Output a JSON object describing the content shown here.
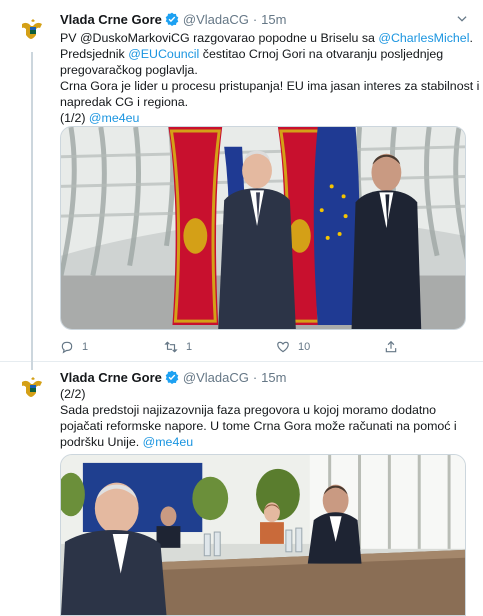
{
  "tweets": [
    {
      "author_name": "Vlada Crne Gore",
      "handle": "@VladaCG",
      "separator": "·",
      "time": "15m",
      "text_lines": [
        [
          {
            "t": "PV @DuskoMarkoviCG razgovarao popodne u Briselu sa "
          },
          {
            "t": "@CharlesMichel",
            "link": true
          },
          {
            "t": "."
          }
        ],
        [
          {
            "t": "Predsjednik "
          },
          {
            "t": "@EUCouncil",
            "link": true
          },
          {
            "t": " čestitao Crnoj Gori na otvaranju posljednjeg"
          }
        ],
        [
          {
            "t": "pregovaračkog poglavlja."
          }
        ],
        [
          {
            "t": "Crna Gora je lider u procesu pristupanja! EU ima jasan interes za stabilnost i"
          }
        ],
        [
          {
            "t": "napredak CG i regiona."
          }
        ],
        [
          {
            "t": "(1/2) "
          },
          {
            "t": "@me4eu",
            "link": true
          }
        ]
      ],
      "replies": "1",
      "retweets": "1",
      "likes": "10"
    },
    {
      "author_name": "Vlada Crne Gore",
      "handle": "@VladaCG",
      "separator": "·",
      "time": "15m",
      "text_lines": [
        [
          {
            "t": "(2/2)"
          }
        ],
        [
          {
            "t": "Sada predstoji najizazovnija faza pregovora u kojoj moramo dodatno"
          }
        ],
        [
          {
            "t": "pojačati reformske napore. U tome Crna Gora može računati na pomoć i"
          }
        ],
        [
          {
            "t": "podršku Unije. "
          },
          {
            "t": "@me4eu",
            "link": true
          }
        ]
      ]
    }
  ],
  "icons": {
    "verified": "verified-badge-icon",
    "caret": "chevron-down-icon",
    "reply": "reply-icon",
    "retweet": "retweet-icon",
    "like": "heart-icon",
    "share": "share-icon"
  },
  "colors": {
    "link": "#1b95e0",
    "verified": "#1da1f2",
    "muted": "#657786",
    "text": "#14171a"
  }
}
